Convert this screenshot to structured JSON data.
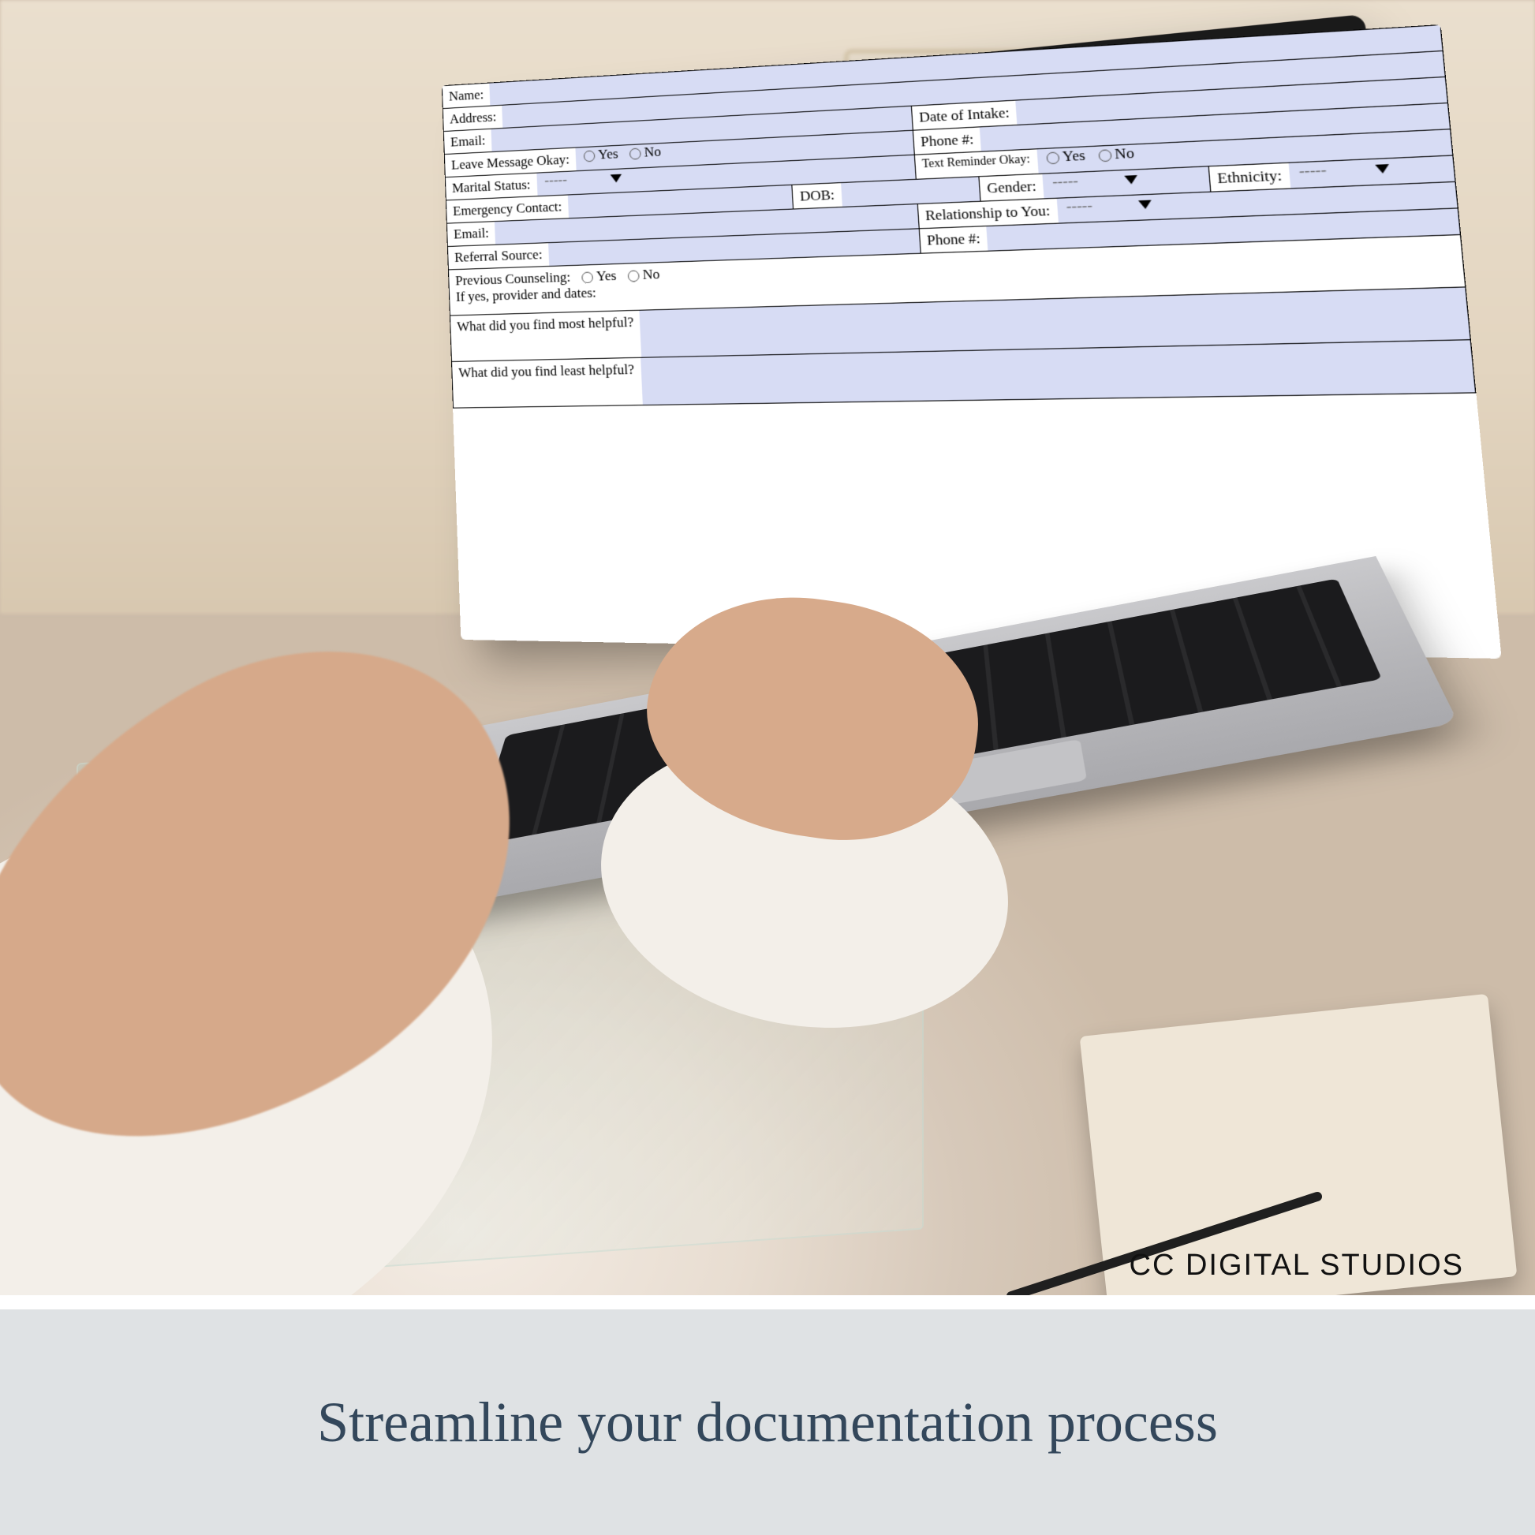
{
  "brand": "CC DIGITAL STUDIOS",
  "banner": {
    "headline": "Streamline your documentation process"
  },
  "form": {
    "name_label": "Name:",
    "address_label": "Address:",
    "email_label": "Email:",
    "date_of_intake_label": "Date of Intake:",
    "leave_msg_label": "Leave Message Okay:",
    "phone_label": "Phone #:",
    "marital_status_label": "Marital Status:",
    "text_reminder_label": "Text Reminder Okay:",
    "emergency_contact_label": "Emergency Contact:",
    "dob_label": "DOB:",
    "gender_label": "Gender:",
    "ethnicity_label": "Ethnicity:",
    "ec_email_label": "Email:",
    "relationship_label": "Relationship to You:",
    "referral_label": "Referral Source:",
    "ec_phone_label": "Phone #:",
    "prev_counseling_label": "Previous Counseling:",
    "prev_details_label": "If yes, provider and dates:",
    "most_helpful_label": "What did you find most helpful?",
    "least_helpful_label": "What did you find least helpful?",
    "yes": "Yes",
    "no": "No",
    "select_placeholder": "-----"
  }
}
